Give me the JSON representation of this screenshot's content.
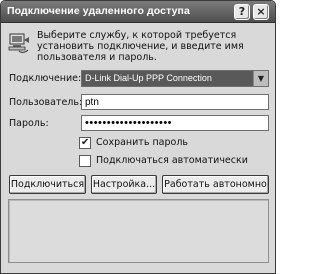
{
  "window": {
    "title": "Подключение удаленного доступа",
    "help_glyph": "?",
    "close_glyph": "×"
  },
  "intro_text": "Выберите службу, к которой требуется установить подключение, и введите имя пользователя и пароль.",
  "form": {
    "connection_label": "Подключение:",
    "connection_value": "D-Link Dial-Up PPP Connection",
    "username_label": "Пользователь:",
    "username_value": "ptn",
    "password_label": "Пароль:",
    "password_value": "••••••••••••••••••••",
    "save_password_label": "Сохранить пароль",
    "save_password_checked": true,
    "auto_connect_label": "Подключаться автоматически",
    "auto_connect_checked": false
  },
  "buttons": {
    "connect": "Подключиться",
    "settings": "Настройка...",
    "offline": "Работать автономно"
  },
  "icons": {
    "title_help": "help-icon",
    "title_close": "close-icon",
    "connection": "computer-connection-icon",
    "dropdown": "chevron-down-icon",
    "checkmark": "checkmark-icon"
  }
}
